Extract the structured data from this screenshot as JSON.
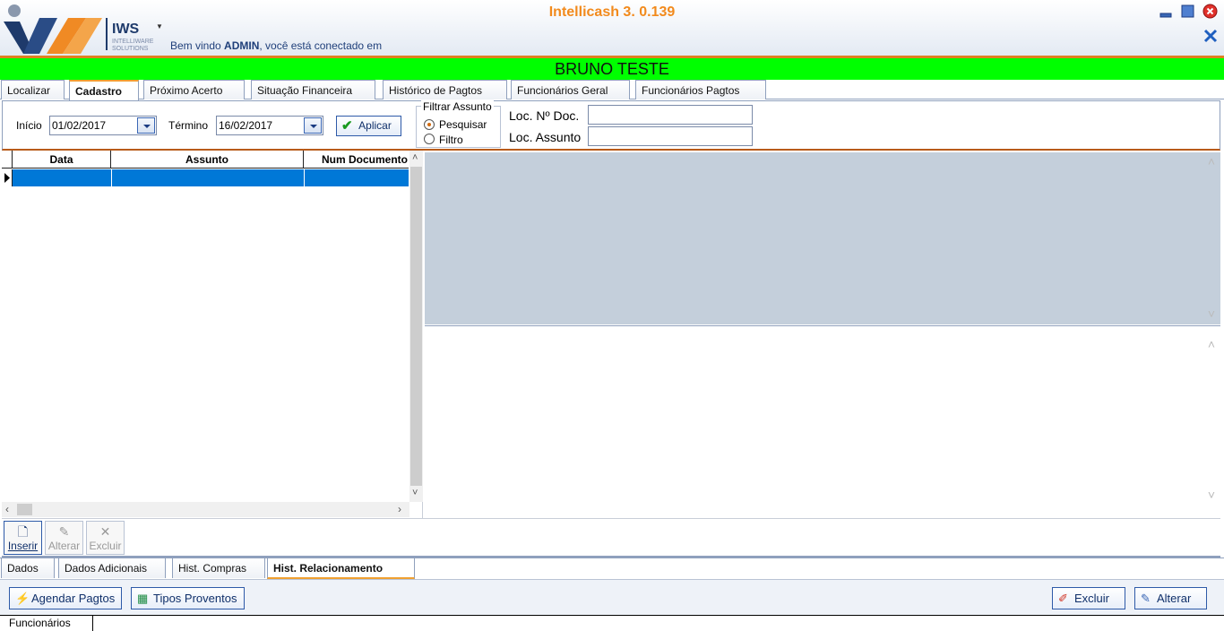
{
  "app": {
    "title": "Intellicash 3. 0.139",
    "logo_text": "IWS",
    "logo_sub1": "INTELLIWARE",
    "logo_sub2": "SOLUTIONS",
    "welcome_prefix": "Bem vindo ",
    "welcome_user": "ADMIN",
    "welcome_suffix": ", você está conectado em"
  },
  "banner": {
    "name": "BRUNO TESTE"
  },
  "main_tabs": [
    "Localizar",
    "Cadastro",
    "Próximo Acerto",
    "Situação Financeira",
    "Histórico de Pagtos",
    "Funcionários Geral",
    "Funcionários Pagtos"
  ],
  "filter": {
    "inicio_label": "Início",
    "inicio_value": "01/02/2017",
    "termino_label": "Término",
    "termino_value": "16/02/2017",
    "apply_label": "Aplicar",
    "group_title": "Filtrar Assunto",
    "radio_pesquisar": "Pesquisar",
    "radio_filtro": "Filtro",
    "loc_doc_label": "Loc. Nº Doc.",
    "loc_assunto_label": "Loc. Assunto"
  },
  "grid": {
    "columns": [
      "Data",
      "Assunto",
      "Num Documento"
    ]
  },
  "toolbar": {
    "insert": "Inserir",
    "edit": "Alterar",
    "delete": "Excluir"
  },
  "sub_tabs": [
    "Dados",
    "Dados Adicionais",
    "Hist. Compras",
    "Hist. Relacionamento"
  ],
  "bottom": {
    "agendar": "Agendar Pagtos",
    "tipos": "Tipos Proventos",
    "excluir": "Excluir",
    "alterar": "Alterar"
  },
  "status": {
    "tab": "Funcionários"
  },
  "colors": {
    "accent": "#f28a1c",
    "banner": "#00ff00",
    "selection": "#0078d7"
  }
}
